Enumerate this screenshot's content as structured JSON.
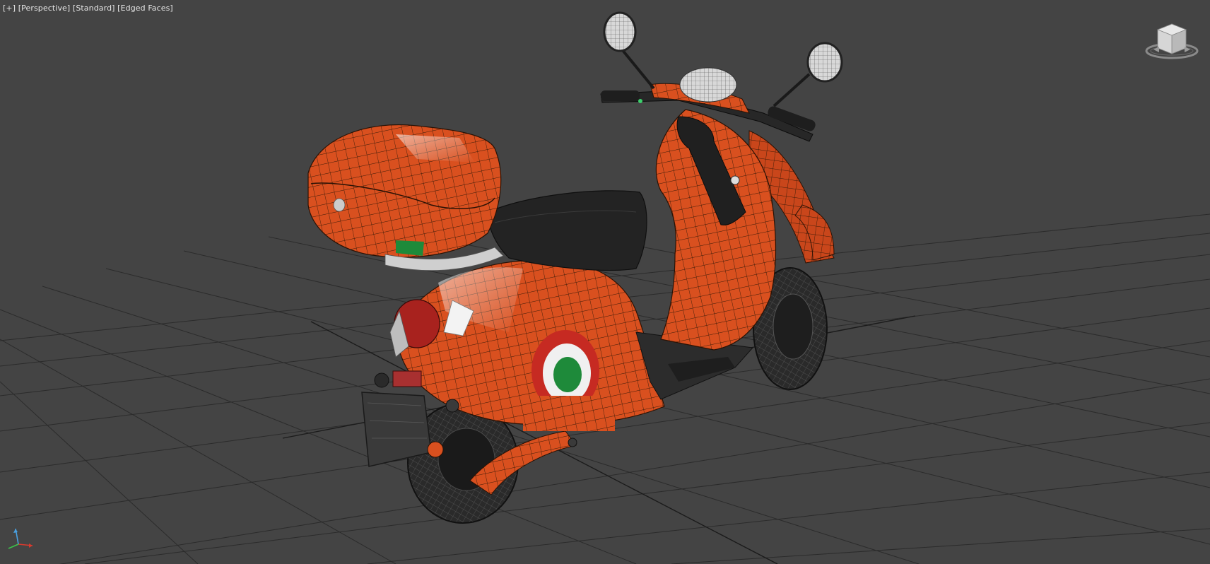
{
  "viewport": {
    "label_parts": [
      "[+]",
      "[Perspective]",
      "[Standard]",
      "[Edged Faces]"
    ]
  },
  "viewcube": {
    "icon": "viewcube-icon"
  },
  "axis_tripod": {
    "icon": "axis-tripod-icon"
  },
  "model": {
    "name": "scooter",
    "colors": {
      "body": "#d9501f",
      "wire": "#3b1b08",
      "seat": "#232323",
      "tire": "#2a2a2a",
      "roundel_red": "#c62a22",
      "roundel_white": "#f0f0f0",
      "roundel_green": "#1e8a3a"
    }
  },
  "colors": {
    "background": "#444444",
    "grid": "#2b2b2b",
    "grid_axis": "#1b1b1b",
    "label": "#e6e6e6"
  }
}
